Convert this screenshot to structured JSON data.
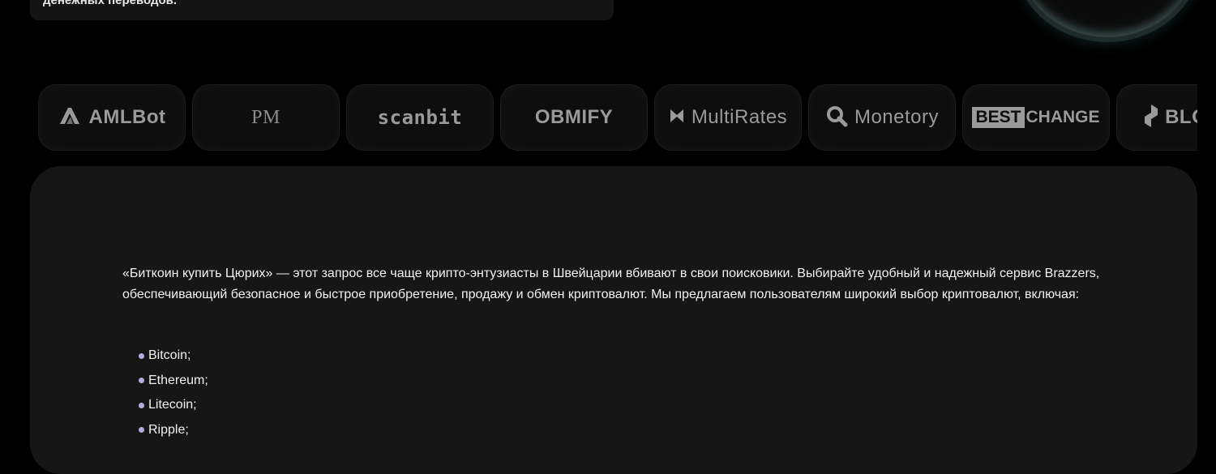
{
  "top_card": {
    "text": "денежных переводов."
  },
  "partners": [
    {
      "name": "AMLBot",
      "icon": "amlbot-logo-icon"
    },
    {
      "name": "PM",
      "icon": "perfect-money-logo-icon"
    },
    {
      "name": "scanbit",
      "icon": "scanbit-logo-icon"
    },
    {
      "name": "OBMIFY",
      "icon": "obmify-logo-icon"
    },
    {
      "name": "MultiRates",
      "icon": "multirates-logo-icon"
    },
    {
      "name": "Monetory",
      "icon": "monetory-logo-icon"
    },
    {
      "name_best": "BEST",
      "name_change": "CHANGE",
      "icon": "bestchange-logo-icon"
    },
    {
      "name": "BLOCK",
      "icon": "block-logo-icon"
    }
  ],
  "article": {
    "intro": "«Биткоин купить Цюрих» — этот запрос все чаще крипто-энтузиасты в Швейцарии вбивают в свои поисковики. Выбирайте удобный и надежный сервис Brazzers, обеспечивающий безопасное и быстрое приобретение, продажу и обмен криптовалют. Мы предлагаем пользователям широкий выбор криптовалют, включая:",
    "coins": [
      "Bitcoin;",
      "Ethereum;",
      "Litecoin;",
      "Ripple;"
    ]
  },
  "colors": {
    "background": "#000000",
    "card": "#161616",
    "bullet": "#b4aee0",
    "logo": "#9a9a9a"
  }
}
